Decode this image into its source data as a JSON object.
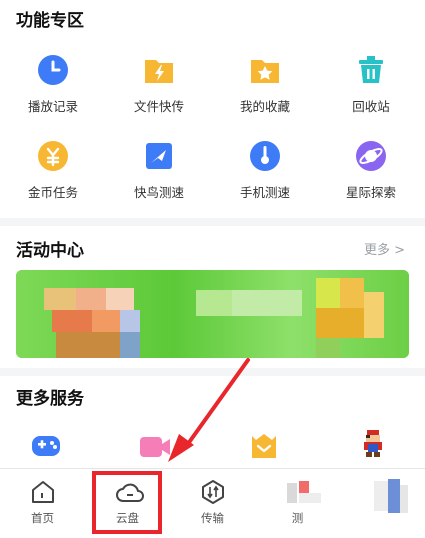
{
  "sections": {
    "features": {
      "title": "功能专区",
      "items": [
        {
          "label": "播放记录",
          "icon": "clock-icon",
          "color": "#3d7bf7"
        },
        {
          "label": "文件快传",
          "icon": "lightning-folder-icon",
          "color": "#f7b733"
        },
        {
          "label": "我的收藏",
          "icon": "star-folder-icon",
          "color": "#f7b733"
        },
        {
          "label": "回收站",
          "icon": "trash-icon",
          "color": "#27c2c8"
        },
        {
          "label": "金币任务",
          "icon": "coin-icon",
          "color": "#f7b733"
        },
        {
          "label": "快鸟测速",
          "icon": "bird-icon",
          "color": "#3d7bf7"
        },
        {
          "label": "手机测速",
          "icon": "thermometer-icon",
          "color": "#3d7bf7"
        },
        {
          "label": "星际探索",
          "icon": "planet-icon",
          "color": "#8a66f0"
        }
      ]
    },
    "activity": {
      "title": "活动中心",
      "more_label": "更多 >"
    },
    "services": {
      "title": "更多服务",
      "icons": [
        "gamepad-icon",
        "video-camera-icon",
        "gift-icon",
        "mario-icon"
      ]
    }
  },
  "tabbar": {
    "tabs": [
      {
        "label": "首页",
        "icon": "home-icon"
      },
      {
        "label": "云盘",
        "icon": "cloud-icon"
      },
      {
        "label": "传输",
        "icon": "transfer-icon"
      },
      {
        "label": "测",
        "icon": "speed-icon"
      },
      {
        "label": "",
        "icon": "profile-icon"
      }
    ]
  },
  "annotation": {
    "box_color": "#e8262b"
  }
}
